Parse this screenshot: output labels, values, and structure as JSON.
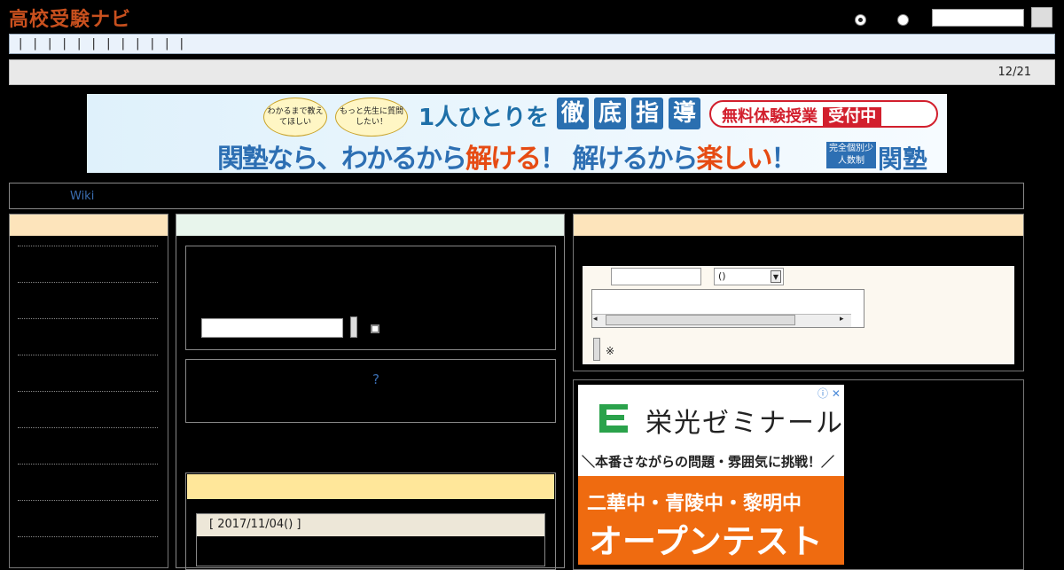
{
  "header": {
    "logo": "高校受験ナビ",
    "search_placeholder": ""
  },
  "navbar": {
    "text": "| | | | | | | | | | | |"
  },
  "datebar": {
    "date": "12/21"
  },
  "banner": {
    "bubble_left": "わかるまで教えてほしい",
    "bubble_right": "もっと先生に質問したい！",
    "headline_prefix": "1人ひとりを",
    "headline_kanji": [
      "徹",
      "底",
      "指",
      "導"
    ],
    "trial_text": "無料体験授業",
    "trial_badge": "受付中",
    "slogan_a": "関塾なら、わかるから",
    "slogan_hl1": "解ける",
    "slogan_b": "！ 解けるから",
    "slogan_hl2": "楽しい",
    "slogan_c": "！",
    "badge": "完全個別少人数制",
    "brand": "関塾"
  },
  "wiki_bar": {
    "label": "Wiki"
  },
  "main": {
    "question_mark": "?",
    "date_header": "[ 2017/11/04() ]"
  },
  "form": {
    "select_value": "()",
    "note": "※"
  },
  "ad": {
    "brand": "栄光ゼミナール",
    "tagline": "＼本番さながらの問題・雰囲気に挑戦！／",
    "schools": "二華中・青陵中・黎明中",
    "event": "オープンテスト",
    "close": "ⓘ ✕"
  },
  "colors": {
    "logo": "#c8501e",
    "accent_orange": "#ef6b10",
    "link_blue": "#3a6db0",
    "panel_peach": "#fde4bb",
    "panel_mint": "#e8f5ec",
    "panel_yellow": "#ffe79a"
  }
}
